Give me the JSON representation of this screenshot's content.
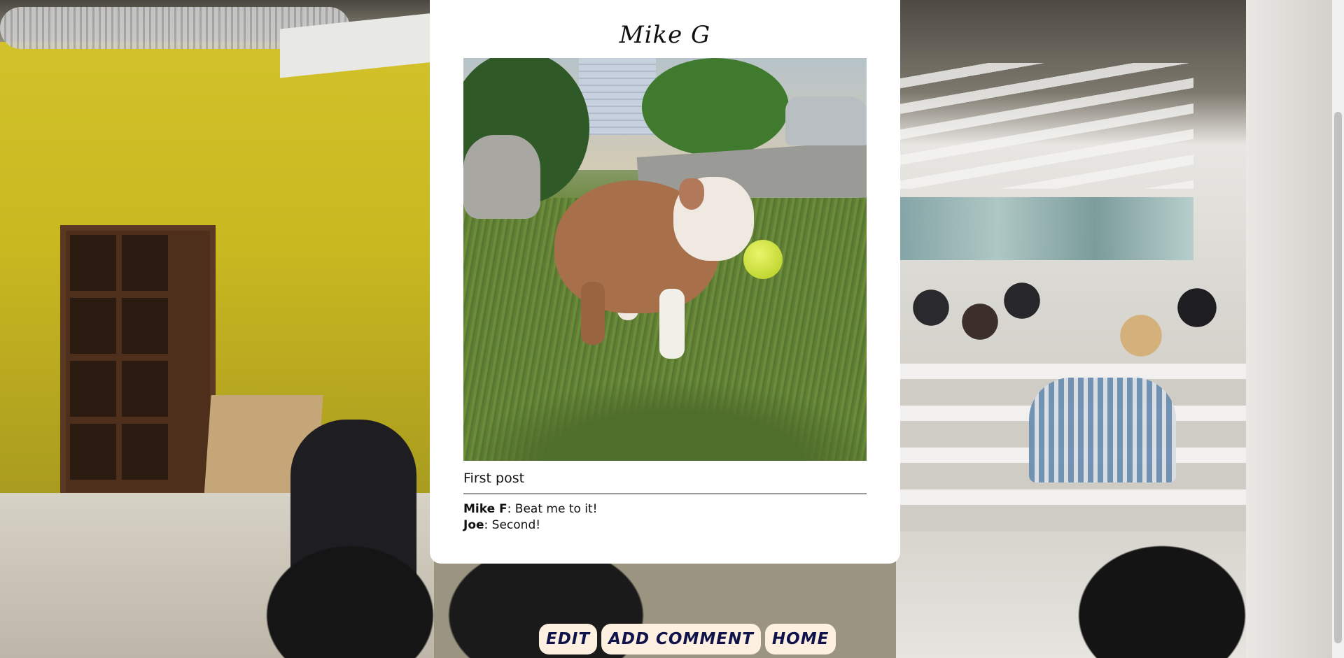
{
  "post": {
    "author": "Mike G",
    "caption": "First post",
    "photo_icon": "bulldog-puppy-photo"
  },
  "comments": [
    {
      "author": "Mike F",
      "text": ": Beat me to it!"
    },
    {
      "author": "Joe",
      "text": ": Second!"
    }
  ],
  "nav": {
    "edit_label": "EDIT",
    "add_comment_label": "ADD COMMENT",
    "home_label": "HOME"
  },
  "colors": {
    "card_background": "#ffffff",
    "button_background": "#fdf0e0",
    "button_text": "#10134a"
  }
}
